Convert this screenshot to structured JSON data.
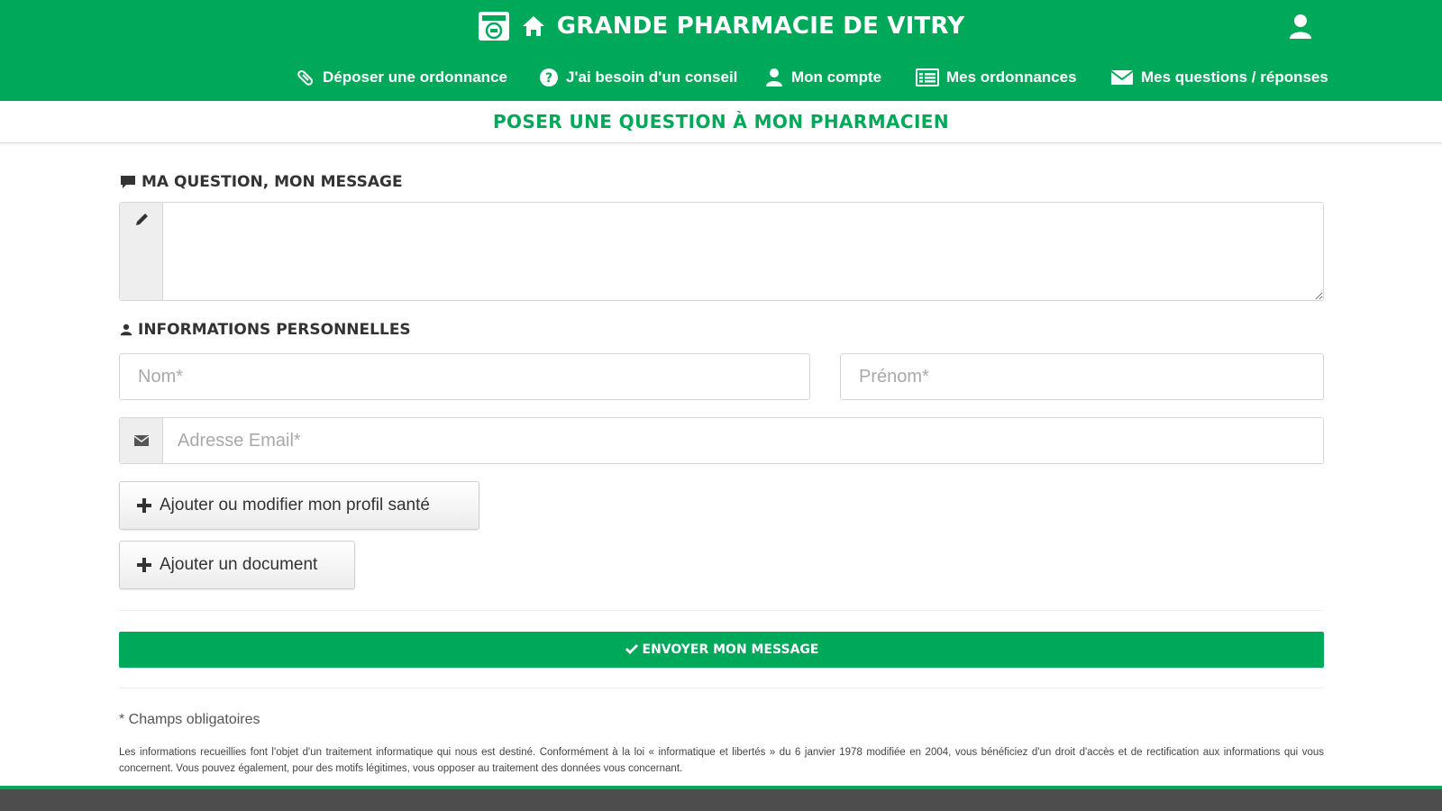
{
  "header": {
    "site_title": "GRANDE PHARMACIE DE VITRY",
    "nav": [
      {
        "label": "Déposer une ordonnance",
        "icon": "pill-icon"
      },
      {
        "label": "J'ai besoin d'un conseil",
        "icon": "question-circle-icon"
      },
      {
        "label": "Mon compte",
        "icon": "user-icon"
      },
      {
        "label": "Mes ordonnances",
        "icon": "list-icon"
      },
      {
        "label": "Mes questions / réponses",
        "icon": "envelope-icon"
      }
    ]
  },
  "page": {
    "title": "POSER UNE QUESTION À MON PHARMACIEN"
  },
  "form": {
    "message_label": "MA QUESTION, MON MESSAGE",
    "message_value": "",
    "personal_label": "INFORMATIONS PERSONNELLES",
    "nom_placeholder": "Nom*",
    "prenom_placeholder": "Prénom*",
    "email_placeholder": "Adresse Email*",
    "profile_button": "Ajouter ou modifier mon profil santé",
    "document_button": "Ajouter un document",
    "submit_label": "ENVOYER MON MESSAGE",
    "required_note": "* Champs obligatoires",
    "legal_text": "Les informations recueillies font l'objet d'un traitement informatique qui nous est destiné. Conformément à la loi « informatique et libertés » du 6 janvier 1978 modifiée en 2004, vous bénéficiez d'un droit d'accès et de rectification aux informations qui vous concernent. Vous pouvez également, pour des motifs légitimes, vous opposer au traitement des données vous concernant."
  },
  "colors": {
    "brand_green": "#00a859",
    "footer_gray": "#4d4d4d"
  }
}
